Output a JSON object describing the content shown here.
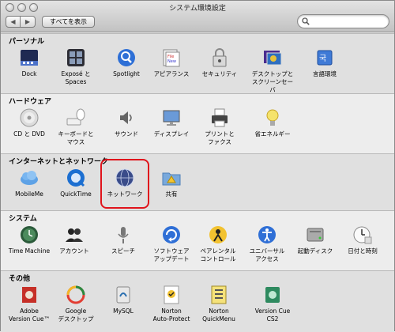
{
  "window": {
    "title": "システム環境設定",
    "show_all_label": "すべてを表示",
    "back_glyph": "◀",
    "forward_glyph": "▶",
    "search_placeholder": ""
  },
  "sections": [
    {
      "header": "パーソナル",
      "items": [
        {
          "label": "Dock",
          "icon": "dock-icon"
        },
        {
          "label": "Exposé と\nSpaces",
          "icon": "expose-icon"
        },
        {
          "label": "Spotlight",
          "icon": "spotlight-icon"
        },
        {
          "label": "アピアランス",
          "icon": "appearance-icon"
        },
        {
          "label": "セキュリティ",
          "icon": "security-icon"
        },
        {
          "label": "デスクトップと\nスクリーンセーバ",
          "icon": "desktop-icon"
        },
        {
          "label": "言語環境",
          "icon": "language-icon"
        }
      ]
    },
    {
      "header": "ハードウェア",
      "items": [
        {
          "label": "CD と DVD",
          "icon": "cd-dvd-icon"
        },
        {
          "label": "キーボードと\nマウス",
          "icon": "keyboard-mouse-icon"
        },
        {
          "label": "サウンド",
          "icon": "sound-icon"
        },
        {
          "label": "ディスプレイ",
          "icon": "display-icon"
        },
        {
          "label": "プリントと\nファクス",
          "icon": "printer-icon"
        },
        {
          "label": "省エネルギー",
          "icon": "energy-saver-icon"
        }
      ]
    },
    {
      "header": "インターネットとネットワーク",
      "items": [
        {
          "label": "MobileMe",
          "icon": "mobileme-icon"
        },
        {
          "label": "QuickTime",
          "icon": "quicktime-icon"
        },
        {
          "label": "ネットワーク",
          "icon": "network-icon"
        },
        {
          "label": "共有",
          "icon": "sharing-icon"
        }
      ]
    },
    {
      "header": "システム",
      "items": [
        {
          "label": "Time Machine",
          "icon": "time-machine-icon"
        },
        {
          "label": "アカウント",
          "icon": "accounts-icon"
        },
        {
          "label": "スピーチ",
          "icon": "speech-icon"
        },
        {
          "label": "ソフトウェア\nアップデート",
          "icon": "software-update-icon"
        },
        {
          "label": "ペアレンタル\nコントロール",
          "icon": "parental-controls-icon"
        },
        {
          "label": "ユニバーサル\nアクセス",
          "icon": "universal-access-icon"
        },
        {
          "label": "起動ディスク",
          "icon": "startup-disk-icon"
        },
        {
          "label": "日付と時刻",
          "icon": "date-time-icon"
        }
      ]
    },
    {
      "header": "その他",
      "items": [
        {
          "label": "Adobe\nVersion Cue™",
          "icon": "adobe-version-cue-icon"
        },
        {
          "label": "Google\nデスクトップ",
          "icon": "google-desktop-icon"
        },
        {
          "label": "MySQL",
          "icon": "mysql-icon"
        },
        {
          "label": "Norton\nAuto-Protect",
          "icon": "norton-autoprotect-icon"
        },
        {
          "label": "Norton\nQuickMenu",
          "icon": "norton-quickmenu-icon"
        },
        {
          "label": "Version Cue\nCS2",
          "icon": "version-cue-cs2-icon"
        }
      ]
    }
  ],
  "colors": {
    "highlight": "#e0141c",
    "accent_blue": "#2e6fd6"
  }
}
